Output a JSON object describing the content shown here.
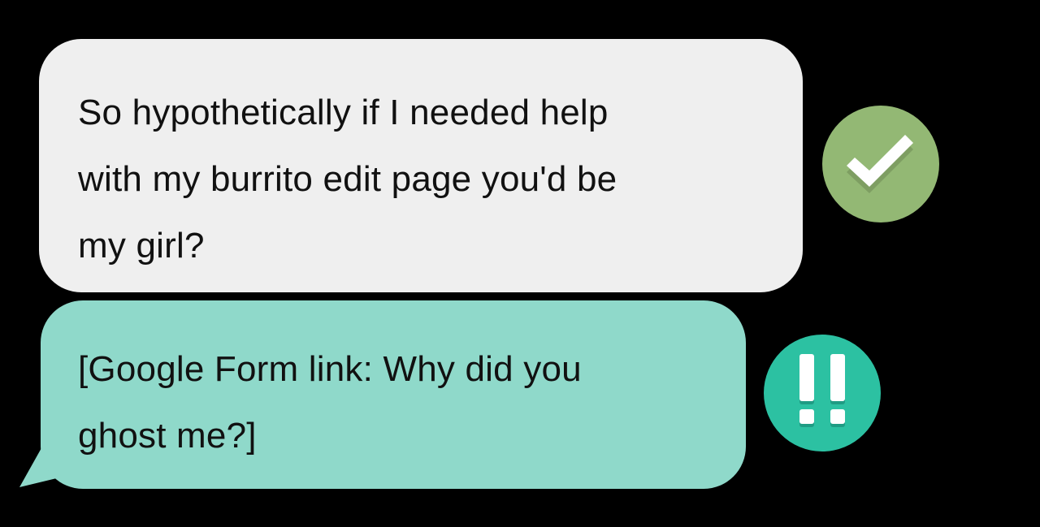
{
  "messages": [
    {
      "lines": [
        "So hypothetically if I needed help",
        "with my burrito edit page you'd be",
        "my girl?"
      ],
      "status_icon": "check-icon",
      "bubble_color": "#efefef",
      "status_color": "#93b874"
    },
    {
      "lines": [
        "[Google Form link: Why did you",
        "ghost me?]"
      ],
      "status_icon": "double-exclamation-icon",
      "bubble_color": "#8fd9ca",
      "status_color": "#2cc1a2"
    }
  ]
}
